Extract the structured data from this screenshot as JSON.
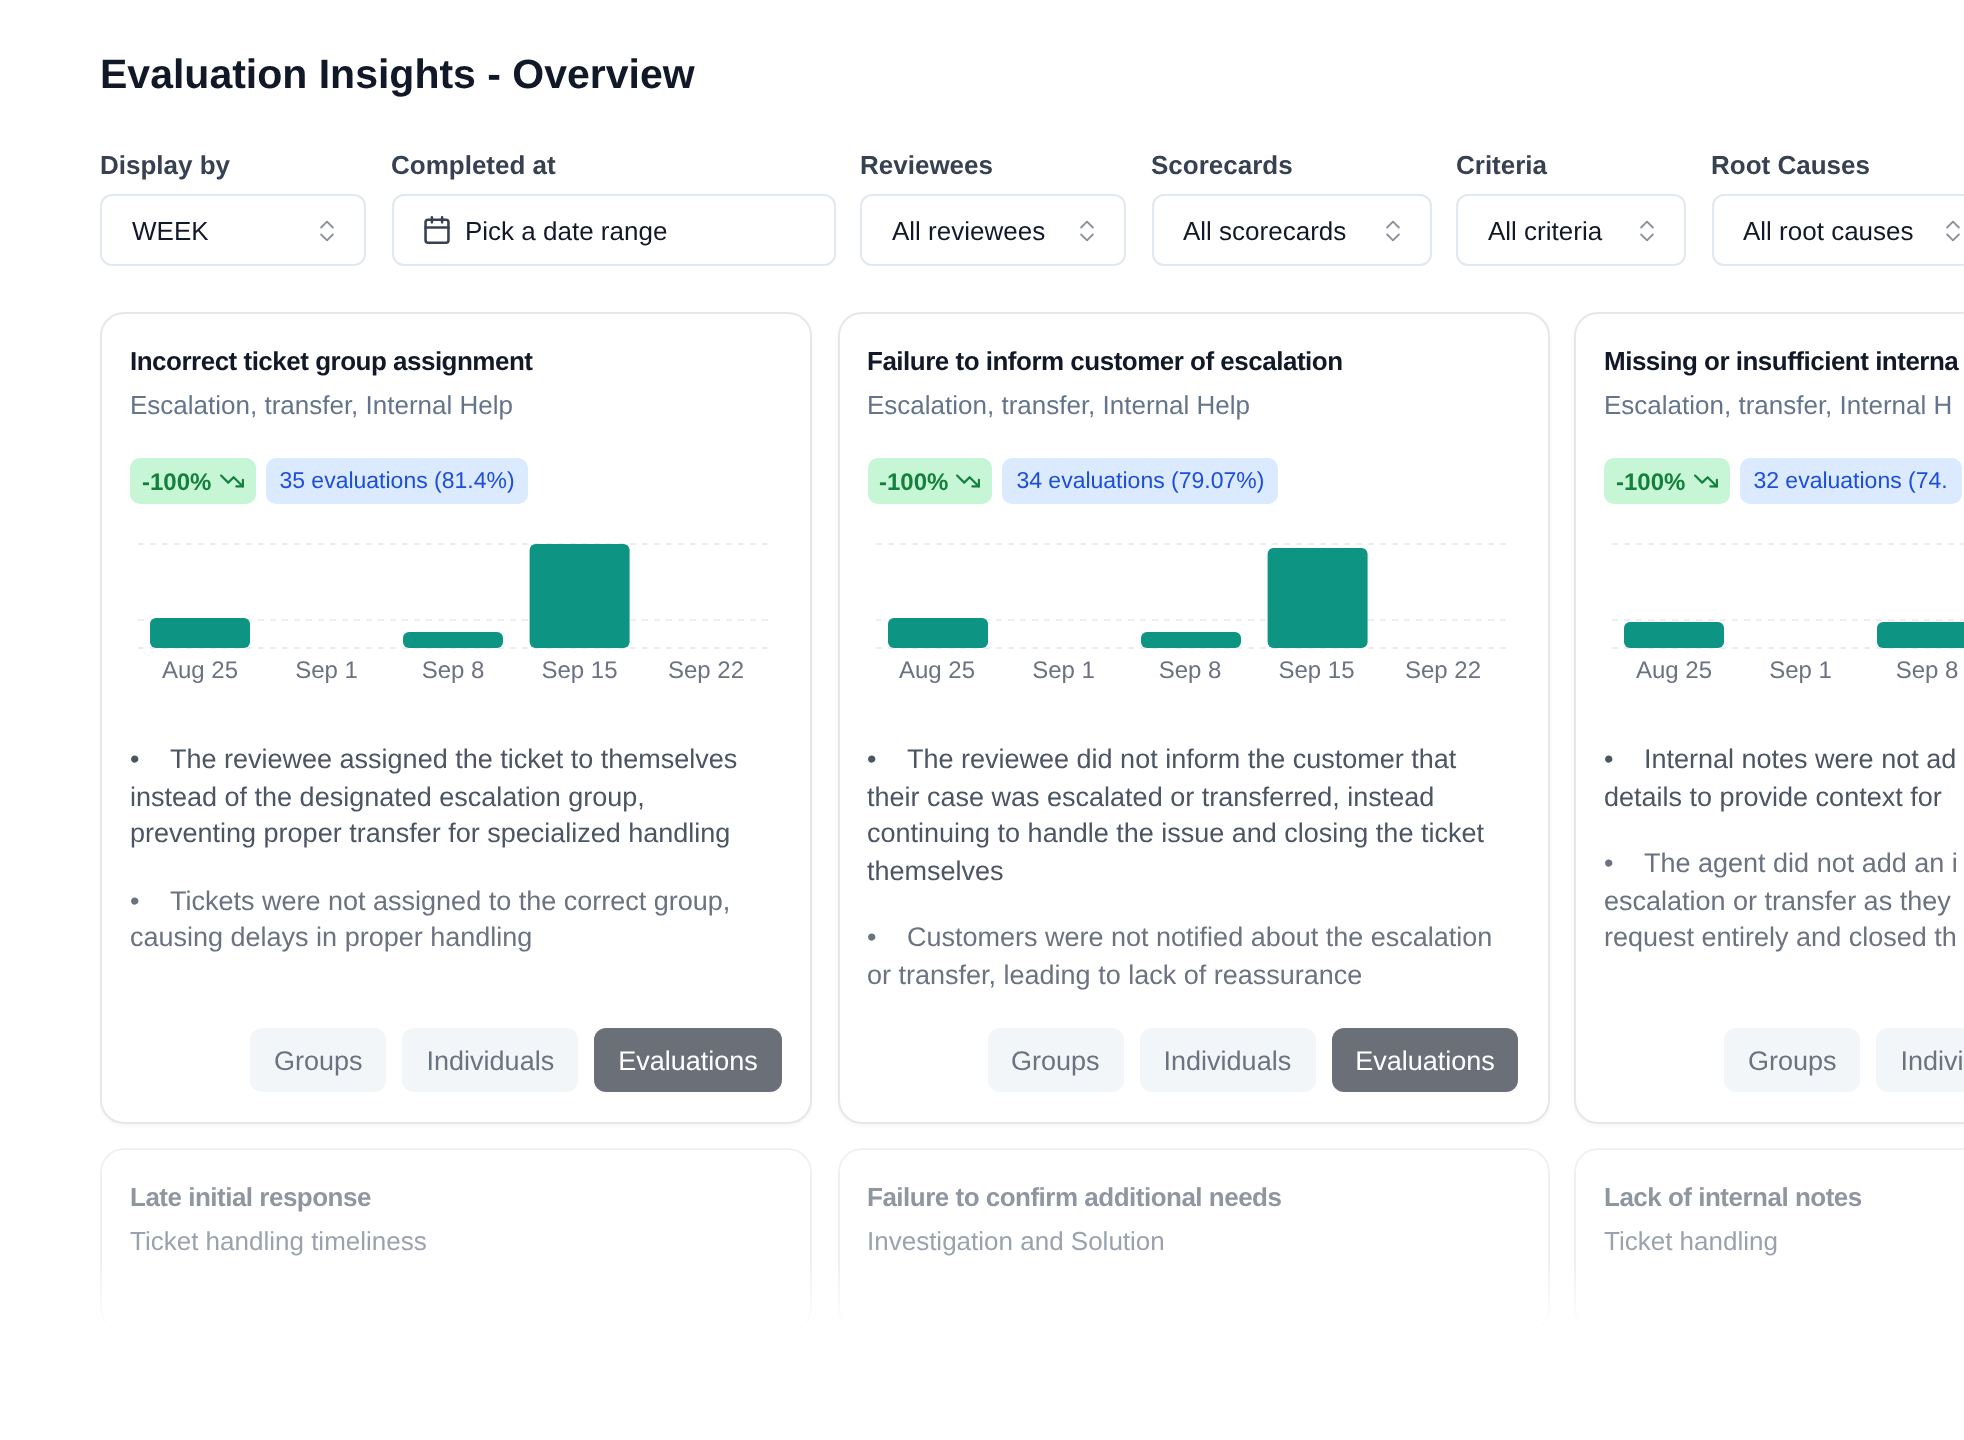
{
  "page": {
    "title": "Evaluation Insights - Overview"
  },
  "filters": [
    {
      "label": "Display by",
      "kind": "select",
      "value": "WEEK"
    },
    {
      "label": "Completed at",
      "kind": "date",
      "value": "Pick a date range"
    },
    {
      "label": "Reviewees",
      "kind": "select",
      "value": "All reviewees"
    },
    {
      "label": "Scorecards",
      "kind": "select",
      "value": "All scorecards"
    },
    {
      "label": "Criteria",
      "kind": "select",
      "value": "All criteria"
    },
    {
      "label": "Root Causes",
      "kind": "select",
      "value": "All root causes"
    }
  ],
  "cards": [
    {
      "title": "Incorrect ticket group assignment",
      "subtitle": "Escalation, transfer, Internal Help",
      "change": "-100%",
      "evaluations": "35 evaluations (81.4%)",
      "axis_labels": [
        "Aug 25",
        "Sep 1",
        "Sep 8",
        "Sep 15",
        "Sep 22"
      ],
      "insights": [
        "•\tThe reviewee assigned the ticket to themselves instead of the designated escalation group, preventing proper transfer for specialized handling",
        "•\tTickets were not assigned to the correct group, causing delays in proper handling"
      ],
      "views": [
        {
          "label": "Groups",
          "selected": false
        },
        {
          "label": "Individuals",
          "selected": false
        },
        {
          "label": "Evaluations",
          "selected": true
        }
      ]
    },
    {
      "title": "Failure to inform customer of escalation",
      "subtitle": "Escalation, transfer, Internal Help",
      "change": "-100%",
      "evaluations": "34 evaluations (79.07%)",
      "axis_labels": [
        "Aug 25",
        "Sep 1",
        "Sep 8",
        "Sep 15",
        "Sep 22"
      ],
      "insights": [
        "•\tThe reviewee did not inform the customer that their case was escalated or transferred, instead continuing to handle the issue and closing the ticket themselves",
        "•\tCustomers were not notified about the escalation or transfer, leading to lack of reassurance"
      ],
      "views": [
        {
          "label": "Groups",
          "selected": false
        },
        {
          "label": "Individuals",
          "selected": false
        },
        {
          "label": "Evaluations",
          "selected": true
        }
      ]
    },
    {
      "title": "Missing or insufficient interna",
      "subtitle": "Escalation, transfer, Internal H",
      "change": "-100%",
      "evaluations": "32 evaluations (74.",
      "axis_labels": [
        "Aug 25",
        "Sep 1",
        "Sep 8"
      ],
      "insights": [
        "•\tInternal notes were not ad\ndetails to provide context for",
        "•\tThe agent did not add an i\nescalation or transfer as they\nrequest entirely and closed th"
      ],
      "views": [
        {
          "label": "Groups",
          "selected": false
        },
        {
          "label": "Indivi",
          "selected": false
        }
      ]
    },
    {
      "title": "Late initial response",
      "subtitle": "Ticket handling timeliness"
    },
    {
      "title": "Failure to confirm additional needs",
      "subtitle": "Investigation and Solution"
    },
    {
      "title": "Lack of internal notes",
      "subtitle": "Ticket handling"
    }
  ]
}
